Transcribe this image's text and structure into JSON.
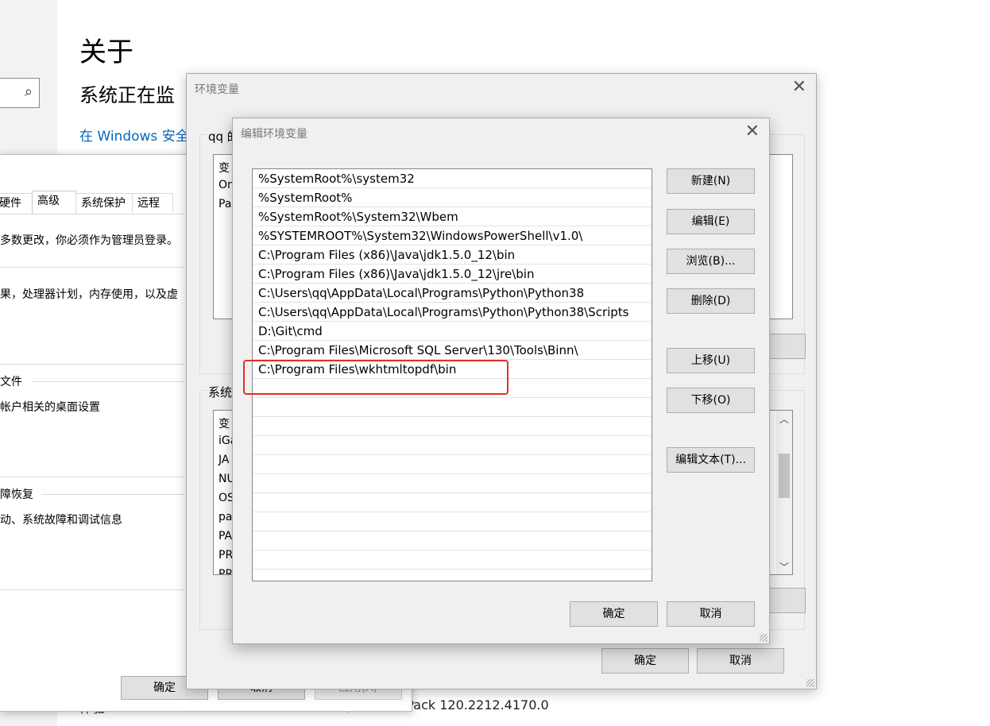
{
  "settings": {
    "title": "关于",
    "subtitle": "系统正在监",
    "link": "在 Windows 安全",
    "search_icon": "⌕",
    "bottom_label": "体验",
    "bottom_value": "Windows Feature Experience Pack 120.2212.4170.0"
  },
  "system_properties": {
    "tabs": [
      "硬件",
      "高级",
      "系统保护",
      "远程"
    ],
    "admin_note": "多数更改，你必须作为管理员登录。",
    "perf_desc": "果，处理器计划，内存使用，以及虚",
    "profile_title": "文件",
    "profile_desc": "帐户相关的桌面设置",
    "startup_title": "障恢复",
    "startup_desc": "动、系统故障和调试信息",
    "ok": "确定",
    "cancel": "取消",
    "apply": "应用(A)"
  },
  "env_vars": {
    "title": "环境变量",
    "user_group": "qq 的",
    "user_vars": [
      "变",
      "On",
      "Pa"
    ],
    "system_group": "系统",
    "system_vars": [
      "变",
      "iGa",
      "JA",
      "NU",
      "OS",
      "pa",
      "PA",
      "PR",
      "PR"
    ],
    "ok": "确定",
    "cancel": "取消"
  },
  "edit_env": {
    "title": "编辑环境变量",
    "paths": [
      "%SystemRoot%\\system32",
      "%SystemRoot%",
      "%SystemRoot%\\System32\\Wbem",
      "%SYSTEMROOT%\\System32\\WindowsPowerShell\\v1.0\\",
      "C:\\Program Files (x86)\\Java\\jdk1.5.0_12\\bin",
      "C:\\Program Files (x86)\\Java\\jdk1.5.0_12\\jre\\bin",
      "C:\\Users\\qq\\AppData\\Local\\Programs\\Python\\Python38",
      "C:\\Users\\qq\\AppData\\Local\\Programs\\Python\\Python38\\Scripts",
      "D:\\Git\\cmd",
      "C:\\Program Files\\Microsoft SQL Server\\130\\Tools\\Binn\\",
      "C:\\Program Files\\wkhtmltopdf\\bin"
    ],
    "buttons": {
      "new": "新建(N)",
      "edit": "编辑(E)",
      "browse": "浏览(B)...",
      "delete": "删除(D)",
      "move_up": "上移(U)",
      "move_down": "下移(O)",
      "edit_text": "编辑文本(T)..."
    },
    "ok": "确定",
    "cancel": "取消"
  },
  "colors": {
    "highlight": "#e0302a",
    "link": "#0067c0"
  }
}
